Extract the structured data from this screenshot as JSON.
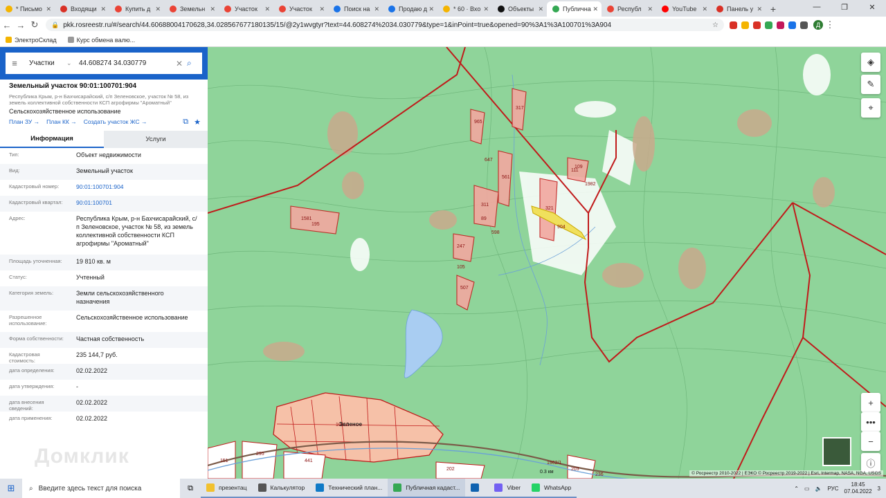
{
  "browser": {
    "tabs": [
      {
        "title": "* Письмо",
        "color": "#f4b400"
      },
      {
        "title": "Входящи",
        "color": "#d93025"
      },
      {
        "title": "Купить д",
        "color": "#ea4335"
      },
      {
        "title": "Земельн",
        "color": "#ea4335"
      },
      {
        "title": "Участок",
        "color": "#ea4335"
      },
      {
        "title": "Участок",
        "color": "#ea4335"
      },
      {
        "title": "Поиск на",
        "color": "#1a73e8"
      },
      {
        "title": "Продаю д",
        "color": "#1a73e8"
      },
      {
        "title": "* 60 · Вхо",
        "color": "#f4b400"
      },
      {
        "title": "Объекты",
        "color": "#111111"
      },
      {
        "title": "Публична",
        "color": "#34a853"
      },
      {
        "title": "Республ",
        "color": "#ea4335"
      },
      {
        "title": "YouTube",
        "color": "#ff0000"
      },
      {
        "title": "Панель у",
        "color": "#d93025"
      }
    ],
    "url": "pkk.rosreestr.ru/#/search/44.60688004170628,34.028567677180135/15/@2y1wvgtyr?text=44.608274%2034.030779&type=1&inPoint=true&opened=90%3A1%3A100701%3A904",
    "bookmarks": [
      "ЭлектроСклад",
      "Курс обмена валю..."
    ]
  },
  "search": {
    "type_label": "Участки",
    "value": "44.608274 34.030779"
  },
  "parcel": {
    "title": "Земельный участок 90:01:100701:904",
    "address_short": "Республика Крым, р-н Бахчисарайский, с/п Зеленовское, участок № 58, из земель коллективной собственности КСП агрофирмы \"Ароматный\"",
    "usage": "Сельскохозяйственное использование",
    "links": [
      "План ЗУ →",
      "План КК →",
      "Создать участок ЖС →"
    ],
    "tabs": [
      "Информация",
      "Услуги"
    ],
    "rows": [
      {
        "k": "Тип:",
        "v": "Объект недвижимости"
      },
      {
        "k": "Вид:",
        "v": "Земельный участок"
      },
      {
        "k": "Кадастровый номер:",
        "v": "90:01:100701:904"
      },
      {
        "k": "Кадастровый квартал:",
        "v": "90:01:100701"
      },
      {
        "k": "Адрес:",
        "v": "Республика Крым, р-н Бахчисарайский, с/п Зеленовское, участок № 58, из земель коллективной собственности КСП агрофирмы \"Ароматный\""
      },
      {
        "k": "Площадь уточненная:",
        "v": "19 810 кв. м"
      },
      {
        "k": "Статус:",
        "v": "Учтенный"
      },
      {
        "k": "Категория земель:",
        "v": "Земли сельскохозяйственного назначения"
      },
      {
        "k": "Разрешенное использование:",
        "v": "Сельскохозяйственное использование"
      },
      {
        "k": "Форма собственности:",
        "v": "Частная собственность"
      },
      {
        "k": "Кадастровая стоимость:",
        "v": "235 144,7 руб."
      },
      {
        "k": "дата определения:",
        "v": "02.02.2022"
      },
      {
        "k": "дата утверждения:",
        "v": "-"
      },
      {
        "k": "дата внесения сведений:",
        "v": "02.02.2022"
      },
      {
        "k": "дата применения:",
        "v": "02.02.2022"
      }
    ],
    "watermark": "Домклик"
  },
  "map": {
    "scale": "0.3 км",
    "attribution": "© Росреестр 2010-2022 | ЕЭКО © Росреестр 2019-2022 | Esri, Intermap, NASA, NGA, USGS",
    "village": "Зеленое",
    "plot_labels": [
      "965",
      "317",
      "561",
      "311",
      "247",
      "111",
      "321",
      "1982",
      "109",
      "904",
      "647",
      "89",
      "598",
      "507",
      "105",
      "1581",
      "195",
      "10110",
      "151",
      "295",
      "441",
      "202",
      "203",
      "236",
      "1962/1"
    ],
    "zoom_in": "+",
    "zoom_out": "−"
  },
  "taskbar": {
    "search": "Введите здесь текст для поиска",
    "apps": [
      {
        "label": "презентац",
        "color": "#f2c12e"
      },
      {
        "label": "Калькулятор",
        "color": "#555555"
      },
      {
        "label": "Технический план...",
        "color": "#0f7ac7"
      },
      {
        "label": "Публичная кадаст...",
        "color": "#34a853"
      },
      {
        "label": "",
        "color": "#0f62b0"
      },
      {
        "label": "Viber",
        "color": "#7360f2"
      },
      {
        "label": "WhatsApp",
        "color": "#25d366"
      }
    ],
    "lang": "РУС",
    "time": "18:45",
    "date": "07.04.2022",
    "notif": "3"
  }
}
